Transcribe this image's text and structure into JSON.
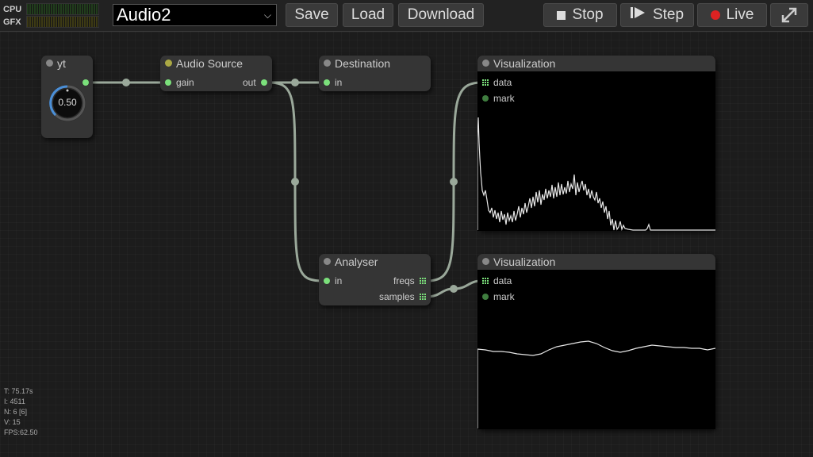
{
  "meters": {
    "cpu_label": "CPU",
    "gfx_label": "GFX"
  },
  "graph_select": {
    "value": "Audio2"
  },
  "toolbar": {
    "save_label": "Save",
    "load_label": "Load",
    "download_label": "Download",
    "stop_label": "Stop",
    "step_label": "Step",
    "live_label": "Live",
    "live_color": "#d22",
    "fullscreen_icon": "expand-icon"
  },
  "nodes": {
    "yt": {
      "title": "yt",
      "knob_value": "0.50",
      "knob_fraction": 0.5
    },
    "audio_source": {
      "title": "Audio Source",
      "input": "gain",
      "output": "out"
    },
    "destination": {
      "title": "Destination",
      "input": "in"
    },
    "analyser": {
      "title": "Analyser",
      "input": "in",
      "output_freqs": "freqs",
      "output_samples": "samples"
    },
    "viz1": {
      "title": "Visualization",
      "input_data": "data",
      "input_mark": "mark"
    },
    "viz2": {
      "title": "Visualization",
      "input_data": "data",
      "input_mark": "mark"
    }
  },
  "stats": {
    "time": "T: 75.17s",
    "iterations": "I: 4511",
    "nodes": "N: 6 [6]",
    "visible": "V: 15",
    "fps": "FPS:62.50"
  },
  "colors": {
    "slot_active": "#7be07b",
    "link": "#9aa89a",
    "node_bg": "#353535"
  }
}
